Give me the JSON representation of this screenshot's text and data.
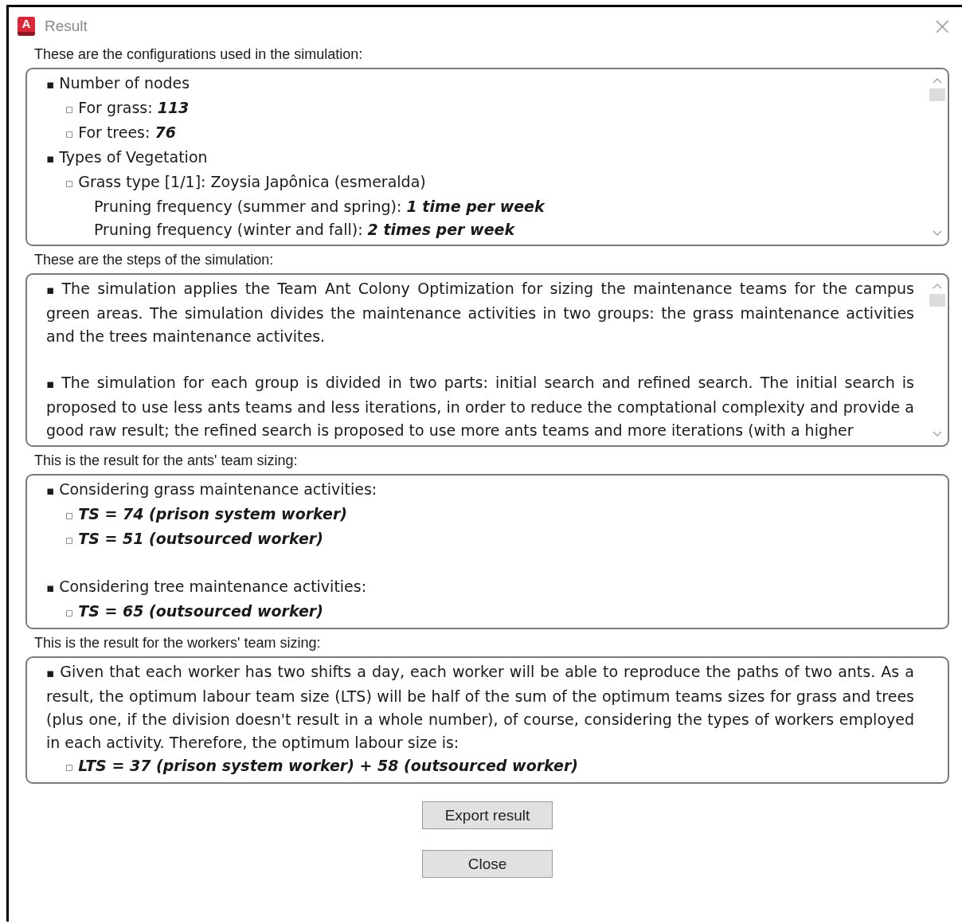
{
  "window": {
    "icon_letter": "A",
    "title": "Result",
    "close": "×"
  },
  "sections": [
    {
      "label": "These are the configurations used in the simulation:",
      "kind": "outline",
      "scrollable": true,
      "items": [
        {
          "bullet": "▪",
          "text": "Number of nodes",
          "children": [
            {
              "bullet": "▫",
              "text": "For grass: **113**"
            },
            {
              "bullet": "▫",
              "text": "For trees: **76**"
            }
          ]
        },
        {
          "bullet": "▪",
          "text": "Types of Vegetation",
          "children": [
            {
              "bullet": "▫",
              "text": "Grass type [1/1]:  Zoysia Japônica (esmeralda)",
              "children": [
                {
                  "text": "Pruning frequency (summer and spring): **1 time per week**"
                },
                {
                  "text": "Pruning frequency (winter and fall): **2 times per week**"
                }
              ]
            }
          ]
        }
      ]
    },
    {
      "label": "These are the steps of the simulation:",
      "kind": "notes",
      "scrollable": true,
      "items": [
        {
          "bullet": "▪",
          "text": "The simulation applies the Team Ant Colony Optimization for sizing the maintenance teams for the campus green areas. The simulation divides the maintenance activities in two groups: the grass maintenance activities and the trees maintenance activites."
        },
        {
          "bullet": "▪",
          "text": "The simulation for each group is divided in two parts: initial search and refined search. The initial search is proposed to use less ants teams and less iterations, in order to reduce the comptational complexity and provide a good raw result; the refined search is proposed to use more ants teams and more iterations (with a higher"
        }
      ]
    },
    {
      "label": "This is the result for the ants' team sizing:",
      "kind": "notes",
      "scrollable": false,
      "items": [
        {
          "bullet": "▪",
          "text": "Considering grass maintenance activities:",
          "children": [
            {
              "bullet": "▫",
              "text": "TS = 74 (prison system worker)",
              "strong": true
            },
            {
              "bullet": "▫",
              "text": "TS = 51 (outsourced worker)",
              "strong": true
            }
          ]
        },
        {
          "bullet": "▪",
          "text": "Considering tree maintenance activities:",
          "children": [
            {
              "bullet": "▫",
              "text": "TS = 65 (outsourced worker)",
              "strong": true
            }
          ]
        }
      ]
    },
    {
      "label": "This is the result for the workers' team sizing:",
      "kind": "notes",
      "scrollable": false,
      "items": [
        {
          "bullet": "▪",
          "text": "Given that each worker has two shifts a day, each worker will be able to reproduce the paths of two ants. As a result, the optimum labour team size (LTS) will be half of the sum of the optimum teams sizes for grass and trees (plus one, if the division doesn't result in a whole number), of course, considering the types of workers employed in each activity. Therefore, the optimum labour size is:",
          "children": [
            {
              "bullet": "▫",
              "text": "LTS = 37 (prison system worker) + 58 (outsourced worker)",
              "strong": true
            }
          ]
        }
      ]
    }
  ],
  "buttons": [
    "Export result",
    "Close"
  ]
}
